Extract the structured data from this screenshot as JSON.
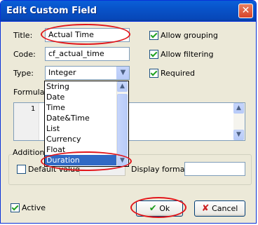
{
  "window": {
    "title": "Edit Custom Field",
    "close_glyph": "✕"
  },
  "fields": {
    "title_label": "Title:",
    "title_value": "Actual Time",
    "code_label": "Code:",
    "code_value": "cf_actual_time",
    "type_label": "Type:",
    "type_value": "Integer",
    "formula_label": "Formula:"
  },
  "checks": {
    "allow_grouping": "Allow grouping",
    "allow_filtering": "Allow filtering",
    "required": "Required"
  },
  "type_options": [
    "String",
    "Date",
    "Time",
    "Date&Time",
    "List",
    "Currency",
    "Float",
    "Duration"
  ],
  "selected_option": "Duration",
  "editor": {
    "line_number": "1"
  },
  "additional": {
    "group_label": "Additional",
    "default_value_label": "Default value:",
    "display_format_label": "Display format:"
  },
  "footer": {
    "active_label": "Active",
    "ok_label": "Ok",
    "cancel_label": "Cancel"
  },
  "colors": {
    "highlight_oval": "#e2161b",
    "selection": "#316ac5",
    "titlebar": "#0a5fd8"
  }
}
